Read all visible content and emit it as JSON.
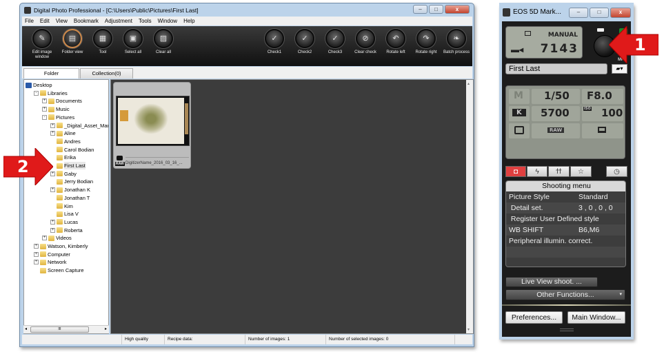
{
  "dpp": {
    "title": "Digital Photo Professional - [C:\\Users\\Public\\Pictures\\First Last]",
    "menu": [
      "File",
      "Edit",
      "View",
      "Bookmark",
      "Adjustment",
      "Tools",
      "Window",
      "Help"
    ],
    "toolbar_left": [
      {
        "label": "Edit image window",
        "icon": "edit-image-icon"
      },
      {
        "label": "Folder view",
        "icon": "folder-view-icon",
        "active": true
      },
      {
        "label": "Tool",
        "icon": "tool-icon"
      },
      {
        "label": "Select all",
        "icon": "select-all-icon"
      },
      {
        "label": "Clear all",
        "icon": "clear-all-icon"
      }
    ],
    "toolbar_right": [
      {
        "label": "Check1",
        "icon": "check1-icon"
      },
      {
        "label": "Check2",
        "icon": "check2-icon"
      },
      {
        "label": "Check3",
        "icon": "check3-icon"
      },
      {
        "label": "Clear check",
        "icon": "clear-check-icon"
      },
      {
        "label": "Rotate left",
        "icon": "rotate-left-icon"
      },
      {
        "label": "Rotate right",
        "icon": "rotate-right-icon"
      },
      {
        "label": "Batch process",
        "icon": "batch-process-icon"
      }
    ],
    "tabs": {
      "folder": "Folder",
      "collection": "Collection(0)"
    },
    "tree": [
      {
        "label": "Desktop",
        "level": 0,
        "exp": ""
      },
      {
        "label": "Libraries",
        "level": 1,
        "exp": "-"
      },
      {
        "label": "Documents",
        "level": 2,
        "exp": "+"
      },
      {
        "label": "Music",
        "level": 2,
        "exp": "+"
      },
      {
        "label": "Pictures",
        "level": 2,
        "exp": "-"
      },
      {
        "label": "_Digital_Asset_Mana",
        "level": 3,
        "exp": "+"
      },
      {
        "label": "Aline",
        "level": 3,
        "exp": "+"
      },
      {
        "label": "Andres",
        "level": 3,
        "exp": ""
      },
      {
        "label": "Carol Bodian",
        "level": 3,
        "exp": ""
      },
      {
        "label": "Erika",
        "level": 3,
        "exp": ""
      },
      {
        "label": "First Last",
        "level": 3,
        "exp": "",
        "selected": true
      },
      {
        "label": "Gaby",
        "level": 3,
        "exp": "+"
      },
      {
        "label": "Jerry Bodian",
        "level": 3,
        "exp": ""
      },
      {
        "label": "Jonathan K",
        "level": 3,
        "exp": "+"
      },
      {
        "label": "Jonathan T",
        "level": 3,
        "exp": ""
      },
      {
        "label": "Kim",
        "level": 3,
        "exp": ""
      },
      {
        "label": "Lisa V",
        "level": 3,
        "exp": ""
      },
      {
        "label": "Lucas",
        "level": 3,
        "exp": "+"
      },
      {
        "label": "Roberta",
        "level": 3,
        "exp": "+"
      },
      {
        "label": "Videos",
        "level": 2,
        "exp": "+"
      },
      {
        "label": "Watson, Kimberly",
        "level": 1,
        "exp": "+"
      },
      {
        "label": "Computer",
        "level": 1,
        "exp": "+"
      },
      {
        "label": "Network",
        "level": 1,
        "exp": "+"
      },
      {
        "label": "Screen Capture",
        "level": 1,
        "exp": ""
      }
    ],
    "thumbnail": {
      "filename": "DigitizerName_2016_03_16_...",
      "badge": "RAW"
    },
    "status": {
      "quality": "High quality",
      "recipe": "Recipe data:",
      "images": "Number of images: 1",
      "selected": "Number of selected images: 0"
    }
  },
  "eos": {
    "title": "EOS 5D Mark...",
    "mode": "MANUAL",
    "shots": "7143",
    "folder_name": "First Last",
    "shooting_mode": "M",
    "shutter": "1/50",
    "aperture": "F8.0",
    "wb_badge": "K",
    "kelvin": "5700",
    "iso_label": "ISO",
    "iso": "100",
    "quality": "RAW",
    "mf_label": "MF",
    "menu_title": "Shooting menu",
    "menu_rows": [
      {
        "label": "Picture Style",
        "value": "Standard"
      },
      {
        "label": " Detail set.",
        "value": "3 , 0 , 0 , 0"
      },
      {
        "label": " Register User Defined style",
        "value": ""
      },
      {
        "label": "WB SHIFT",
        "value": "B6,M6"
      },
      {
        "label": "Peripheral illumin. correct.",
        "value": ""
      },
      {
        "label": "",
        "value": ""
      },
      {
        "label": "",
        "value": ""
      }
    ],
    "live_view": "Live View shoot. ...",
    "other_functions": "Other Functions...",
    "preferences": "Preferences...",
    "main_window": "Main Window..."
  },
  "callouts": {
    "one": "1",
    "two": "2",
    "color": "#e01a1a"
  }
}
